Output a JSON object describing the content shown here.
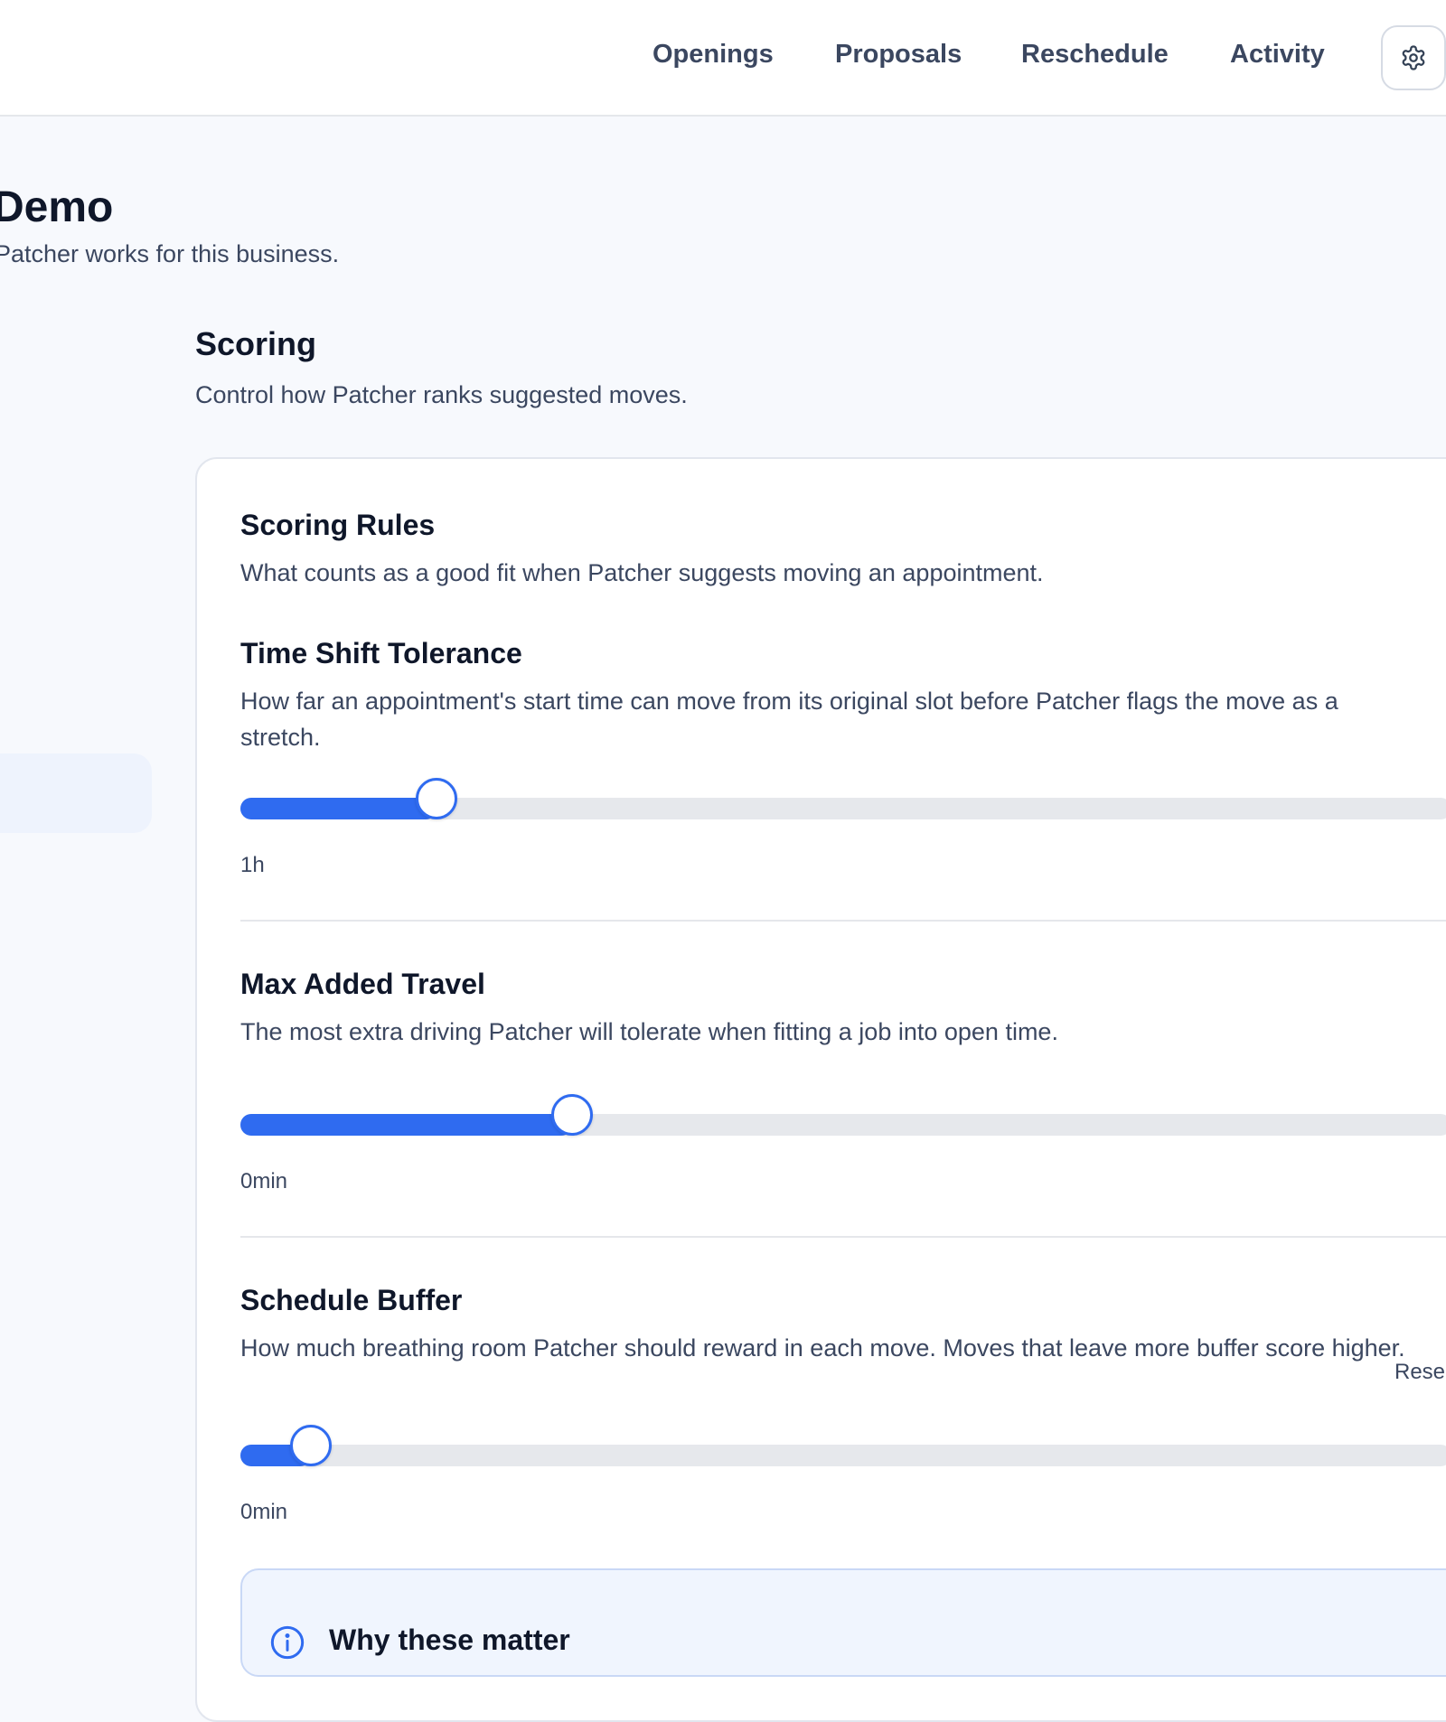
{
  "nav": {
    "items": [
      {
        "label": "Openings"
      },
      {
        "label": "Proposals"
      },
      {
        "label": "Reschedule"
      },
      {
        "label": "Activity"
      }
    ],
    "settings_icon": "gear-icon"
  },
  "page": {
    "title": "Demo",
    "subtitle": "Patcher works for this business."
  },
  "section": {
    "title": "Scoring",
    "description": "Control how Patcher ranks suggested moves."
  },
  "card": {
    "title": "Scoring Rules",
    "description": "What counts as a good fit when Patcher suggests moving an appointment.",
    "settings": [
      {
        "title": "Time Shift Tolerance",
        "description": "How far an appointment's start time can move from its original slot before Patcher flags the move as a stretch.",
        "value_label": "1h",
        "level": 0.162
      },
      {
        "title": "Max Added Travel",
        "description": "The most extra driving Patcher will tolerate when fitting a job into open time.",
        "value_label": "0min",
        "level": 0.274
      },
      {
        "title": "Schedule Buffer",
        "description": "How much breathing room Patcher should reward in each move. Moves that leave more buffer score higher.",
        "value_label": "0min",
        "level": 0.058,
        "reset_label": "Rese"
      }
    ],
    "info": {
      "title": "Why these matter",
      "icon": "info-icon"
    }
  },
  "colors": {
    "accent": "#2f6bf0",
    "track": "#e6e8ec",
    "text_primary": "#0f172a",
    "text_secondary": "#3b4760",
    "page_background": "#f7f9fd"
  }
}
